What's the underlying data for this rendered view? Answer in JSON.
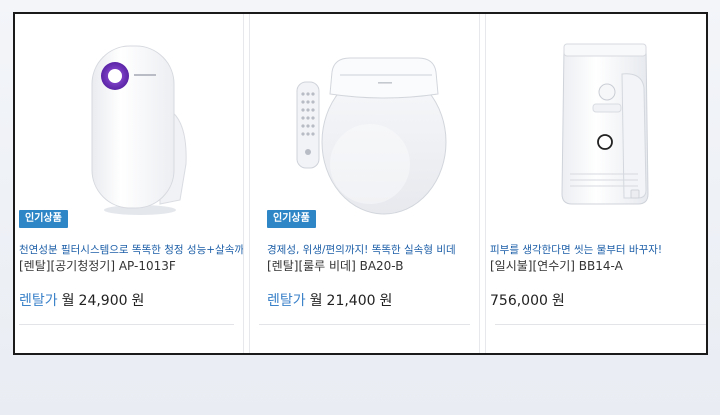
{
  "products": [
    {
      "badge": "인기상품",
      "promo": "천연성분 필터시스템으로 똑똑한 청정 성능+살속까지",
      "model": "[렌탈][공기청정기] AP-1013F",
      "price_prefix": "렌탈가",
      "price_won_label": "월",
      "price_value": "24,900",
      "price_unit": "원",
      "image_icon": "air-purifier-image"
    },
    {
      "badge": "인기상품",
      "promo": "경제성, 위생/편의까지! 똑똑한 실속형 비데",
      "model": "[렌탈][룰루 비데] BA20-B",
      "price_prefix": "렌탈가",
      "price_won_label": "월",
      "price_value": "21,400",
      "price_unit": "원",
      "image_icon": "bidet-image"
    },
    {
      "promo": "피부를 생각한다면 씻는 물부터 바꾸자!",
      "model": "[일시불][연수기] BB14-A",
      "price_value": "756,000",
      "price_unit": "원",
      "image_icon": "water-softener-image"
    }
  ],
  "colors": {
    "badge_bg": "#2f86c7",
    "promo_text": "#1d5fa8",
    "rental_price_label": "#3b82c9",
    "accent_purple": "#6a2fb3"
  }
}
